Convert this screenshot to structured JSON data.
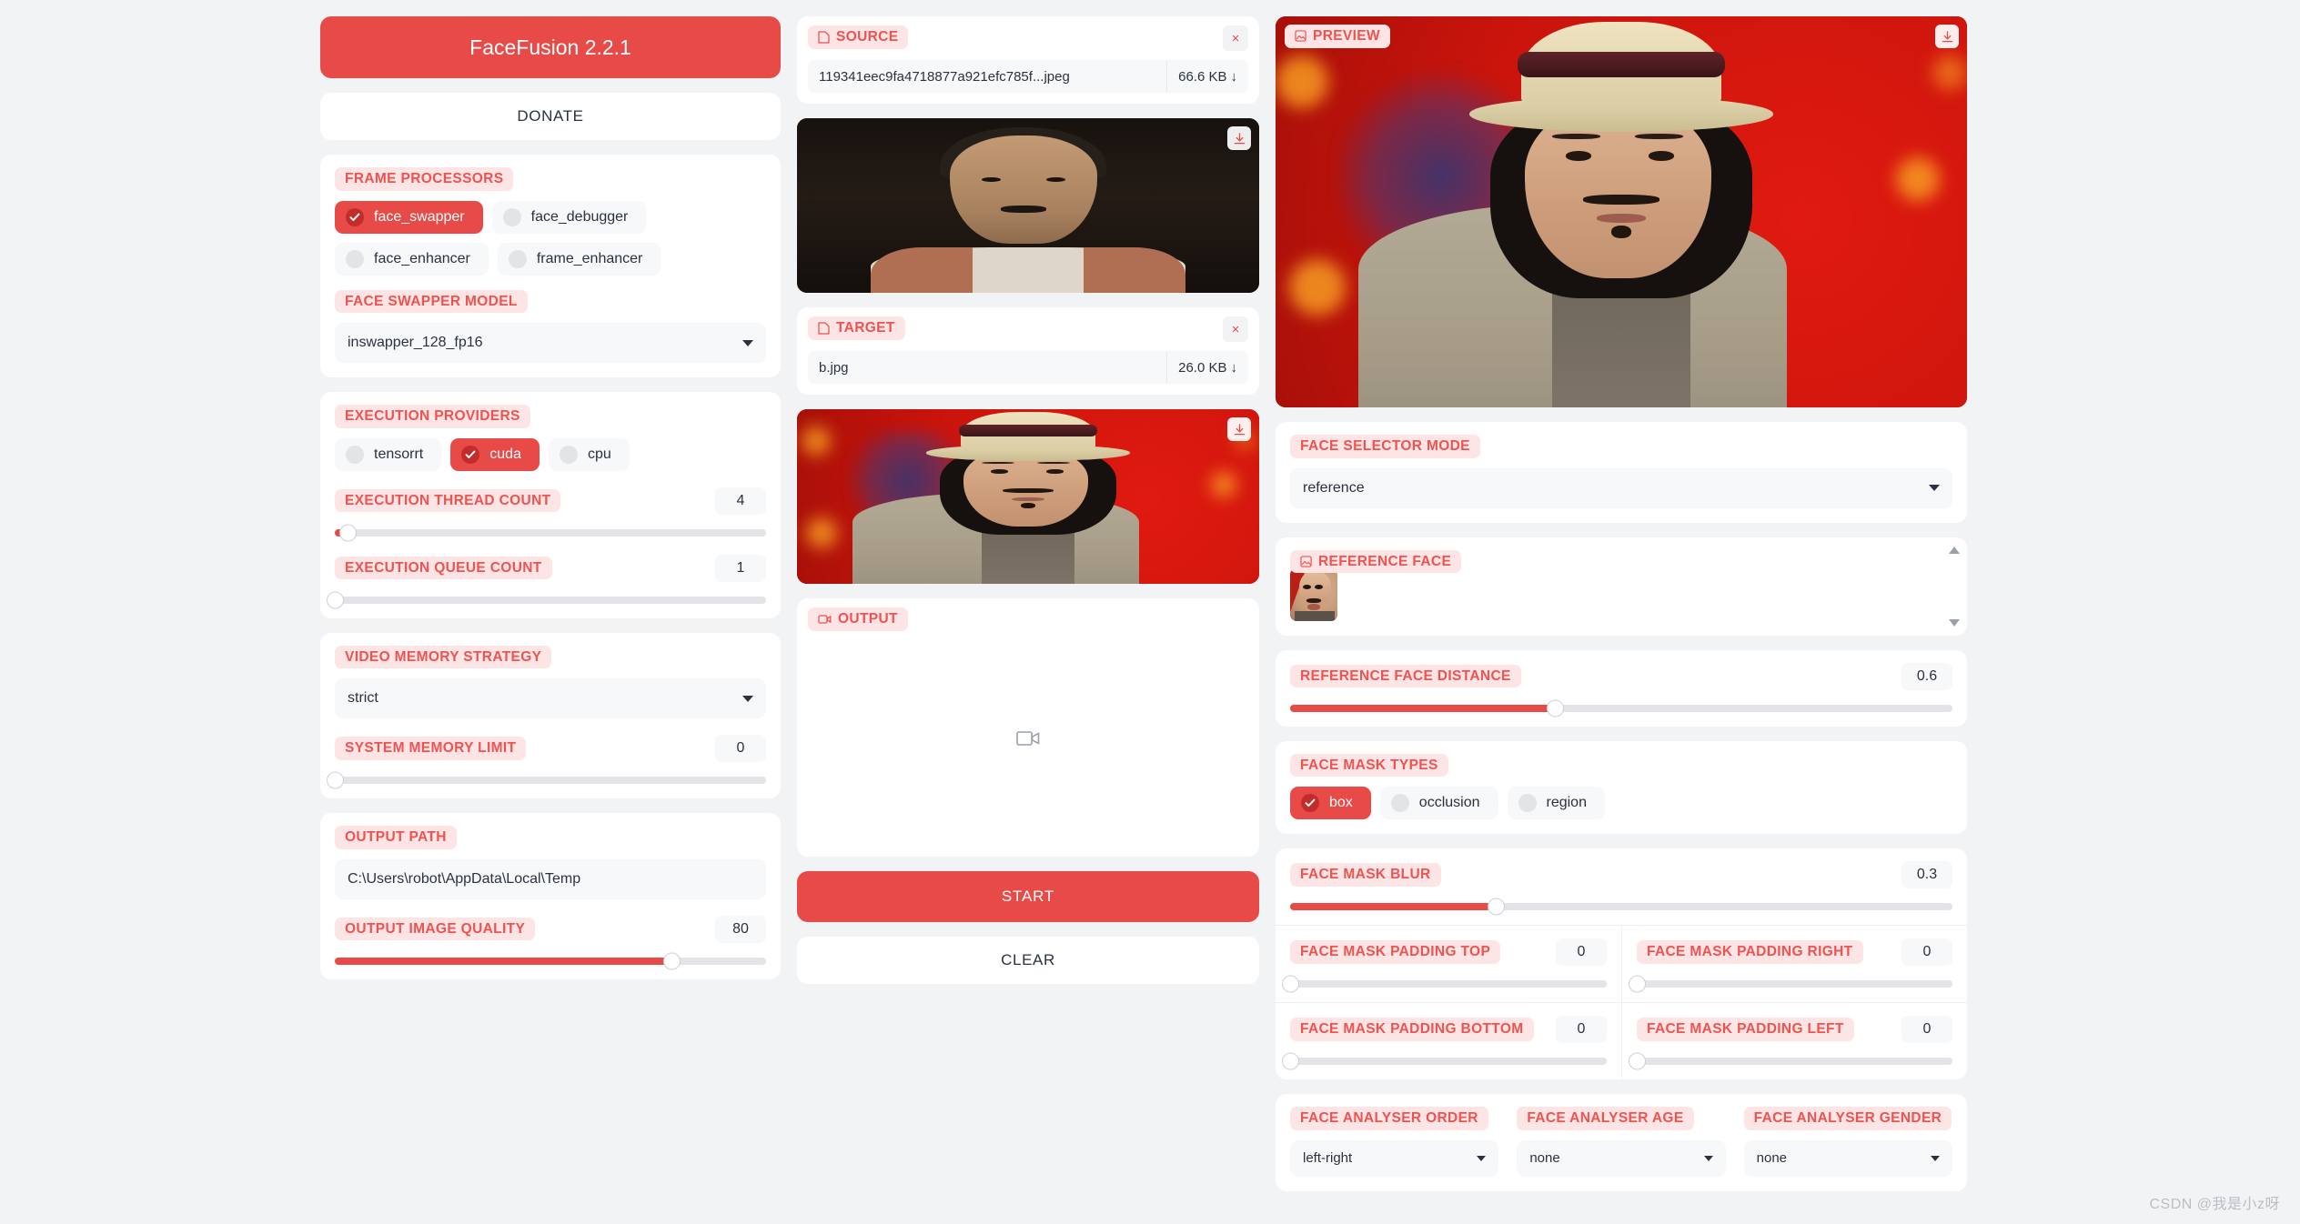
{
  "app": {
    "title": "FaceFusion 2.2.1",
    "donate_label": "DONATE",
    "watermark": "CSDN @我是小z呀",
    "accent_color": "#e84a48",
    "accent_soft": "#fde5e5",
    "page_bg": "#f2f3f5"
  },
  "frame_processors": {
    "label": "FRAME PROCESSORS",
    "options": [
      {
        "name": "face_swapper",
        "checked": true
      },
      {
        "name": "face_debugger",
        "checked": false
      },
      {
        "name": "face_enhancer",
        "checked": false
      },
      {
        "name": "frame_enhancer",
        "checked": false
      }
    ]
  },
  "face_swapper_model": {
    "label": "FACE SWAPPER MODEL",
    "value": "inswapper_128_fp16"
  },
  "execution_providers": {
    "label": "EXECUTION PROVIDERS",
    "options": [
      {
        "name": "tensorrt",
        "checked": false
      },
      {
        "name": "cuda",
        "checked": true
      },
      {
        "name": "cpu",
        "checked": false
      }
    ]
  },
  "execution_thread_count": {
    "label": "EXECUTION THREAD COUNT",
    "value": "4",
    "percent": 3
  },
  "execution_queue_count": {
    "label": "EXECUTION QUEUE COUNT",
    "value": "1",
    "percent": 0
  },
  "video_memory_strategy": {
    "label": "VIDEO MEMORY STRATEGY",
    "value": "strict"
  },
  "system_memory_limit": {
    "label": "SYSTEM MEMORY LIMIT",
    "value": "0",
    "percent": 0
  },
  "output_path": {
    "label": "OUTPUT PATH",
    "value": "C:\\Users\\robot\\AppData\\Local\\Temp"
  },
  "output_image_quality": {
    "label": "OUTPUT IMAGE QUALITY",
    "value": "80",
    "percent": 78
  },
  "source": {
    "label": "SOURCE",
    "icon": "file-icon",
    "file_name": "119341eec9fa4718877a921efc785f...jpeg",
    "file_size": "66.6 KB",
    "close_label": "×",
    "download_icon": "download-icon"
  },
  "target": {
    "label": "TARGET",
    "icon": "file-icon",
    "file_name": "b.jpg",
    "file_size": "26.0 KB",
    "close_label": "×",
    "download_icon": "download-icon"
  },
  "output": {
    "label": "OUTPUT",
    "icon": "video-icon",
    "placeholder_icon": "video-camera-icon"
  },
  "actions": {
    "start_label": "START",
    "clear_label": "CLEAR"
  },
  "preview": {
    "label": "PREVIEW",
    "icon": "image-icon",
    "download_icon": "download-icon"
  },
  "face_selector_mode": {
    "label": "FACE SELECTOR MODE",
    "value": "reference"
  },
  "reference_face": {
    "label": "REFERENCE FACE",
    "icon": "image-icon",
    "scroll_up_icon": "chevron-up-icon",
    "scroll_down_icon": "chevron-down-icon"
  },
  "reference_face_distance": {
    "label": "REFERENCE FACE DISTANCE",
    "value": "0.6",
    "percent": 40
  },
  "face_mask_types": {
    "label": "FACE MASK TYPES",
    "options": [
      {
        "name": "box",
        "checked": true
      },
      {
        "name": "occlusion",
        "checked": false
      },
      {
        "name": "region",
        "checked": false
      }
    ]
  },
  "face_mask_blur": {
    "label": "FACE MASK BLUR",
    "value": "0.3",
    "percent": 31
  },
  "face_mask_padding": {
    "top": {
      "label": "FACE MASK PADDING TOP",
      "value": "0",
      "percent": 0
    },
    "right": {
      "label": "FACE MASK PADDING RIGHT",
      "value": "0",
      "percent": 0
    },
    "bottom": {
      "label": "FACE MASK PADDING BOTTOM",
      "value": "0",
      "percent": 0
    },
    "left": {
      "label": "FACE MASK PADDING LEFT",
      "value": "0",
      "percent": 0
    }
  },
  "face_analyser": {
    "order": {
      "label": "FACE ANALYSER ORDER",
      "value": "left-right"
    },
    "age": {
      "label": "FACE ANALYSER AGE",
      "value": "none"
    },
    "gender": {
      "label": "FACE ANALYSER GENDER",
      "value": "none"
    }
  }
}
